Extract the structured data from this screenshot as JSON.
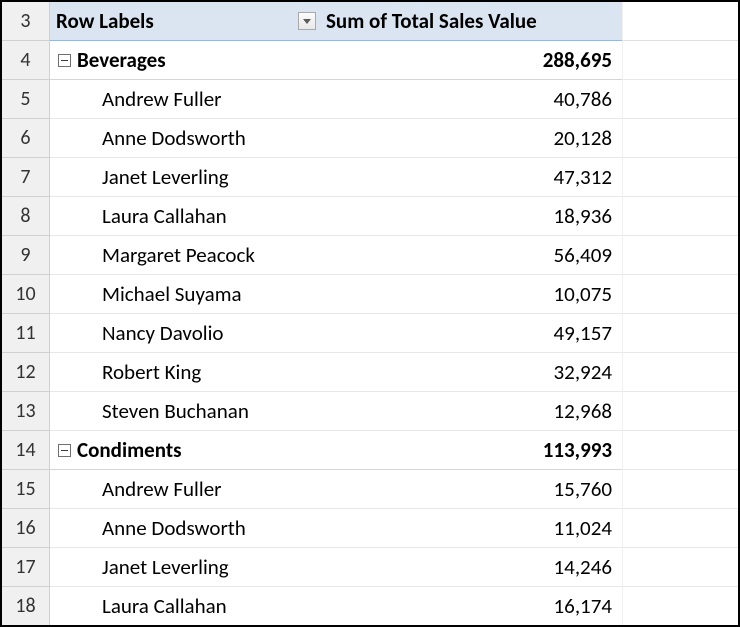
{
  "header": {
    "rowLabels": "Row Labels",
    "sumLabel": "Sum of Total Sales Value",
    "rowNumber": "3"
  },
  "groups": [
    {
      "rowNumber": "4",
      "name": "Beverages",
      "total": "288,695",
      "items": [
        {
          "rowNumber": "5",
          "name": "Andrew Fuller",
          "value": "40,786"
        },
        {
          "rowNumber": "6",
          "name": "Anne Dodsworth",
          "value": "20,128"
        },
        {
          "rowNumber": "7",
          "name": "Janet Leverling",
          "value": "47,312"
        },
        {
          "rowNumber": "8",
          "name": "Laura Callahan",
          "value": "18,936"
        },
        {
          "rowNumber": "9",
          "name": "Margaret Peacock",
          "value": "56,409"
        },
        {
          "rowNumber": "10",
          "name": "Michael Suyama",
          "value": "10,075"
        },
        {
          "rowNumber": "11",
          "name": "Nancy Davolio",
          "value": "49,157"
        },
        {
          "rowNumber": "12",
          "name": "Robert King",
          "value": "32,924"
        },
        {
          "rowNumber": "13",
          "name": "Steven Buchanan",
          "value": "12,968"
        }
      ]
    },
    {
      "rowNumber": "14",
      "name": "Condiments",
      "total": "113,993",
      "items": [
        {
          "rowNumber": "15",
          "name": "Andrew Fuller",
          "value": "15,760"
        },
        {
          "rowNumber": "16",
          "name": "Anne Dodsworth",
          "value": "11,024"
        },
        {
          "rowNumber": "17",
          "name": "Janet Leverling",
          "value": "14,246"
        },
        {
          "rowNumber": "18",
          "name": "Laura Callahan",
          "value": "16,174"
        }
      ]
    }
  ]
}
